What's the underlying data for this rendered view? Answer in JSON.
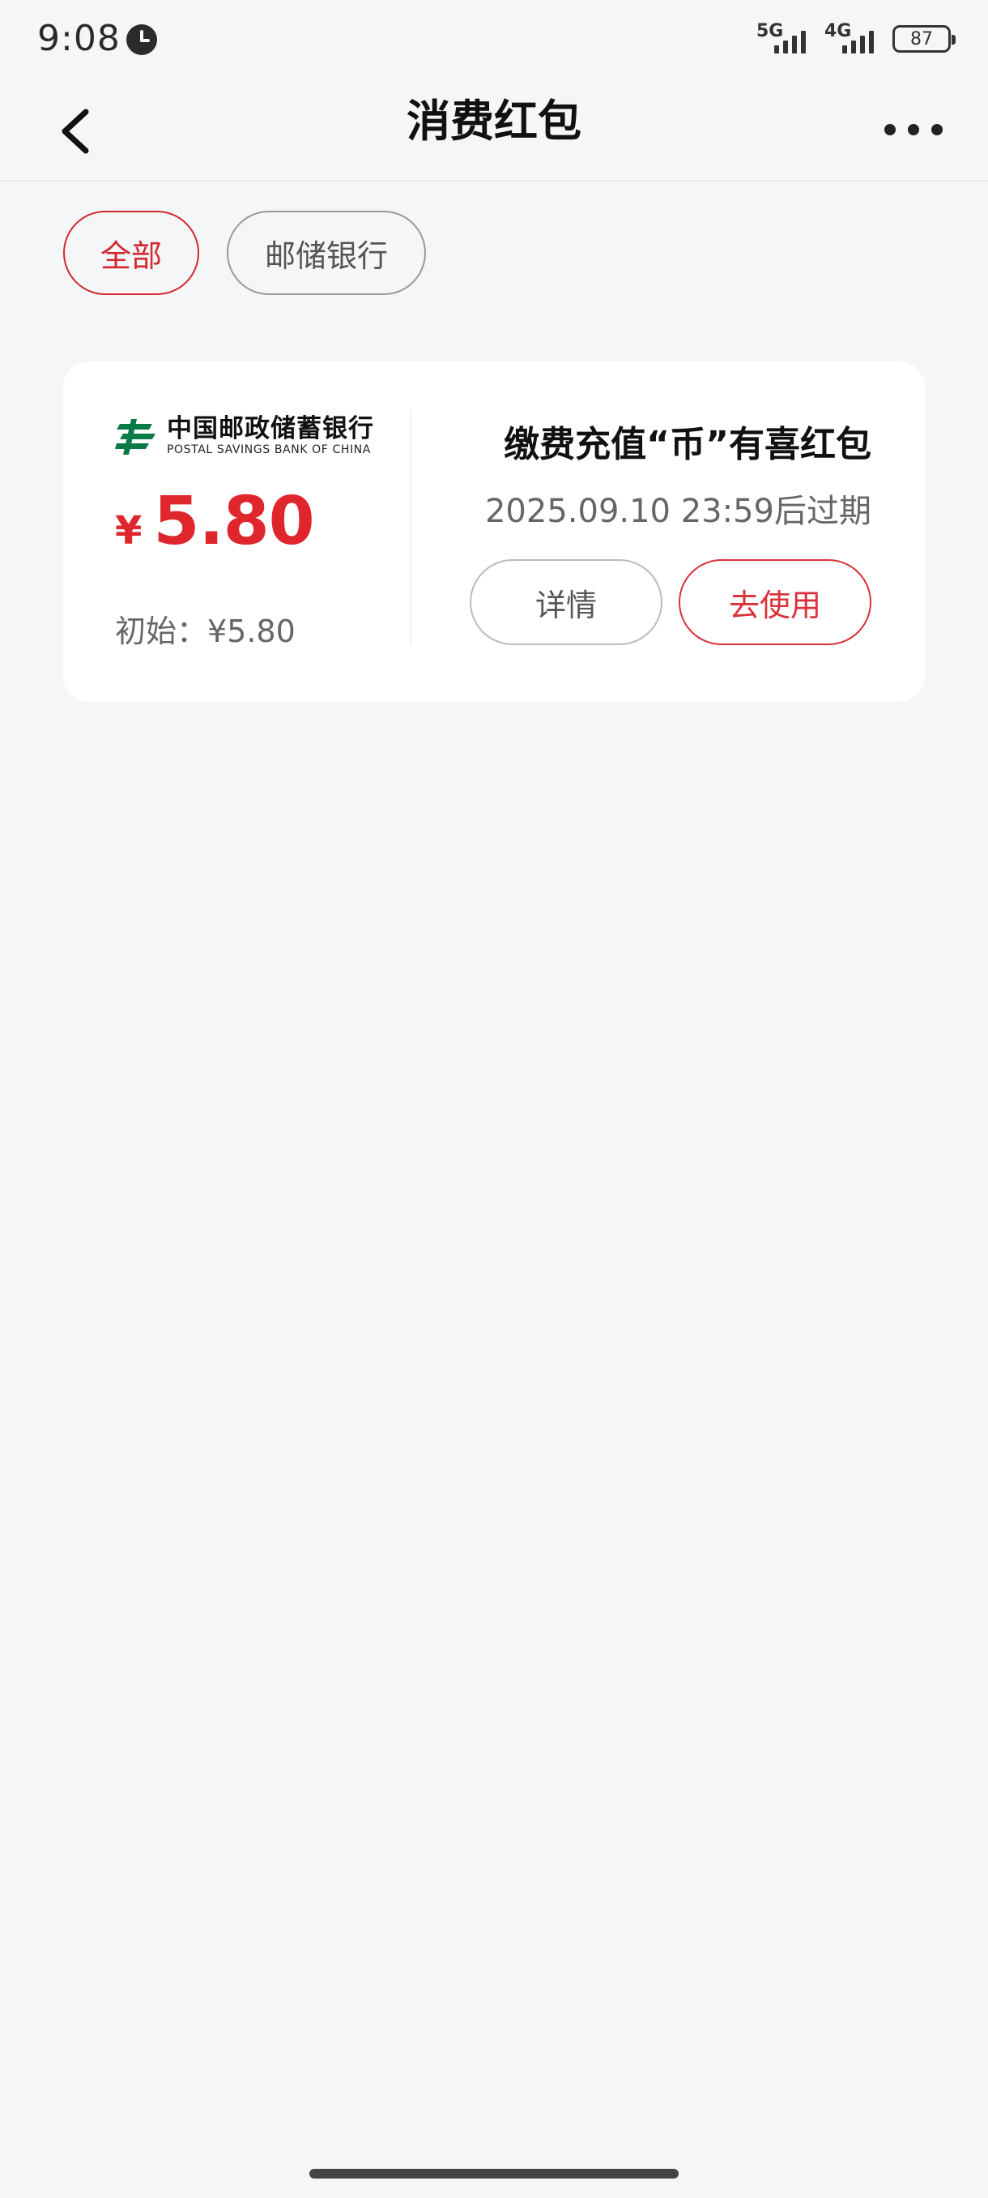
{
  "status_bar": {
    "time": "9:08",
    "network_1": "5G",
    "network_2": "4G",
    "battery": "87",
    "icons": [
      "alarm-icon",
      "signal-icon",
      "battery-icon"
    ]
  },
  "header": {
    "title": "消费红包",
    "back_icon": "chevron-left-icon",
    "more_icon": "more-dots-icon"
  },
  "filters": [
    {
      "label": "全部",
      "selected": true
    },
    {
      "label": "邮储银行",
      "selected": false
    }
  ],
  "card": {
    "bank_name_cn": "中国邮政储蓄银行",
    "bank_name_en": "POSTAL SAVINGS BANK OF CHINA",
    "currency": "¥",
    "amount": "5.80",
    "initial": "初始：¥5.80",
    "title": "缴费充值“币”有喜红包",
    "expire": "2025.09.10 23:59后过期",
    "detail_button": "详情",
    "use_button": "去使用"
  },
  "colors": {
    "accent": "#d2282f",
    "amount": "#e0262d",
    "logo_green": "#0a7b46",
    "background": "#f5f6f8"
  }
}
